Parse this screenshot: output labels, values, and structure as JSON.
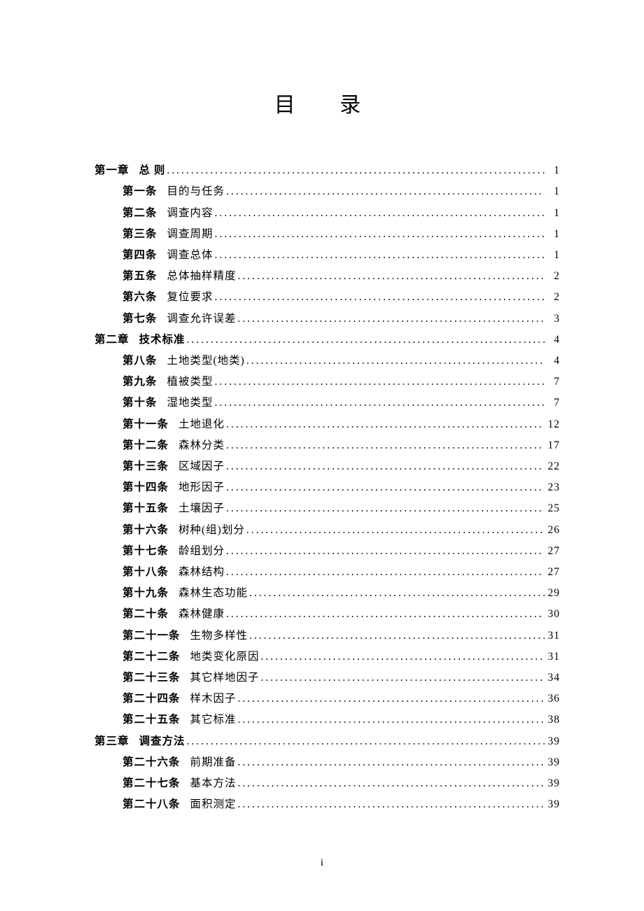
{
  "title": "目  录",
  "footer": "i",
  "toc": [
    {
      "type": "chapter",
      "no": "第一章",
      "label": "总  则",
      "page": "1"
    },
    {
      "type": "article",
      "no": "第一条",
      "label": "目的与任务",
      "page": "1"
    },
    {
      "type": "article",
      "no": "第二条",
      "label": "调查内容",
      "page": "1"
    },
    {
      "type": "article",
      "no": "第三条",
      "label": "调查周期",
      "page": "1"
    },
    {
      "type": "article",
      "no": "第四条",
      "label": "调查总体",
      "page": "1"
    },
    {
      "type": "article",
      "no": "第五条",
      "label": "总体抽样精度",
      "page": "2"
    },
    {
      "type": "article",
      "no": "第六条",
      "label": "复位要求",
      "page": "2"
    },
    {
      "type": "article",
      "no": "第七条",
      "label": "调查允许误差",
      "page": "3"
    },
    {
      "type": "chapter",
      "no": "第二章",
      "label": "技术标准",
      "page": "4"
    },
    {
      "type": "article",
      "no": "第八条",
      "label": "土地类型(地类)",
      "page": "4"
    },
    {
      "type": "article",
      "no": "第九条",
      "label": "植被类型",
      "page": "7"
    },
    {
      "type": "article",
      "no": "第十条",
      "label": "湿地类型",
      "page": "7"
    },
    {
      "type": "article",
      "no": "第十一条",
      "label": "土地退化",
      "page": "12"
    },
    {
      "type": "article",
      "no": "第十二条",
      "label": "森林分类",
      "page": "17"
    },
    {
      "type": "article",
      "no": "第十三条",
      "label": "区域因子",
      "page": "22"
    },
    {
      "type": "article",
      "no": "第十四条",
      "label": "地形因子",
      "page": "23"
    },
    {
      "type": "article",
      "no": "第十五条",
      "label": "土壤因子",
      "page": "25"
    },
    {
      "type": "article",
      "no": "第十六条",
      "label": "树种(组)划分",
      "page": "26"
    },
    {
      "type": "article",
      "no": "第十七条",
      "label": "龄组划分",
      "page": "27"
    },
    {
      "type": "article",
      "no": "第十八条",
      "label": "森林结构",
      "page": "27"
    },
    {
      "type": "article",
      "no": "第十九条",
      "label": "森林生态功能",
      "page": "29"
    },
    {
      "type": "article",
      "no": "第二十条",
      "label": "森林健康",
      "page": "30"
    },
    {
      "type": "article",
      "no": "第二十一条",
      "label": "生物多样性",
      "page": "31"
    },
    {
      "type": "article",
      "no": "第二十二条",
      "label": "地类变化原因",
      "page": "31"
    },
    {
      "type": "article",
      "no": "第二十三条",
      "label": "其它样地因子",
      "page": "34"
    },
    {
      "type": "article",
      "no": "第二十四条",
      "label": "样木因子",
      "page": "36"
    },
    {
      "type": "article",
      "no": "第二十五条",
      "label": "其它标准",
      "page": "38"
    },
    {
      "type": "chapter",
      "no": "第三章",
      "label": "调查方法",
      "page": "39"
    },
    {
      "type": "article",
      "no": "第二十六条",
      "label": "前期准备",
      "page": "39"
    },
    {
      "type": "article",
      "no": "第二十七条",
      "label": "基本方法",
      "page": "39"
    },
    {
      "type": "article",
      "no": "第二十八条",
      "label": "面积测定",
      "page": "39"
    }
  ]
}
